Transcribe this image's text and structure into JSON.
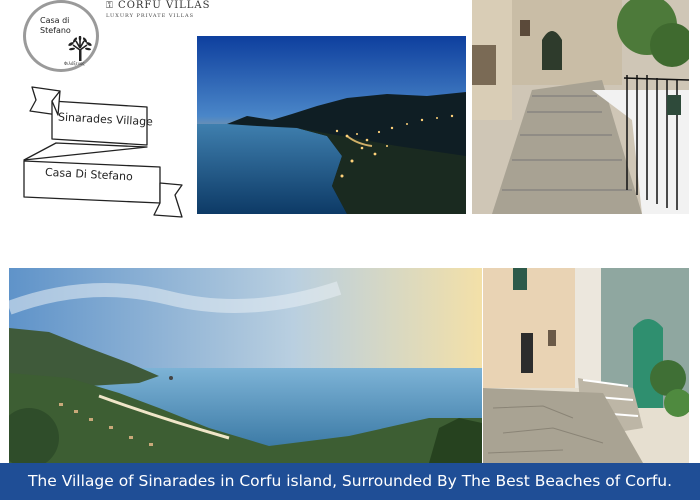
{
  "logo": {
    "name_line1": "Casa di",
    "name_line2": "Stefano",
    "tagline": "Φιλόξενος"
  },
  "brand": {
    "title": "CORFU VILLAS",
    "subtitle": "LUXURY PRIVATE VILLAS"
  },
  "banner": {
    "top_text": "Sinarades Village",
    "bottom_text": "Casa Di Stefano"
  },
  "caption": "The Village of Sinarades in Corfu island, Surrounded By The Best Beaches of Corfu.",
  "colors": {
    "caption_bar": "#1f4e96",
    "sea": "#2f6f9c",
    "sky_dusk": "#1c3f7a"
  }
}
